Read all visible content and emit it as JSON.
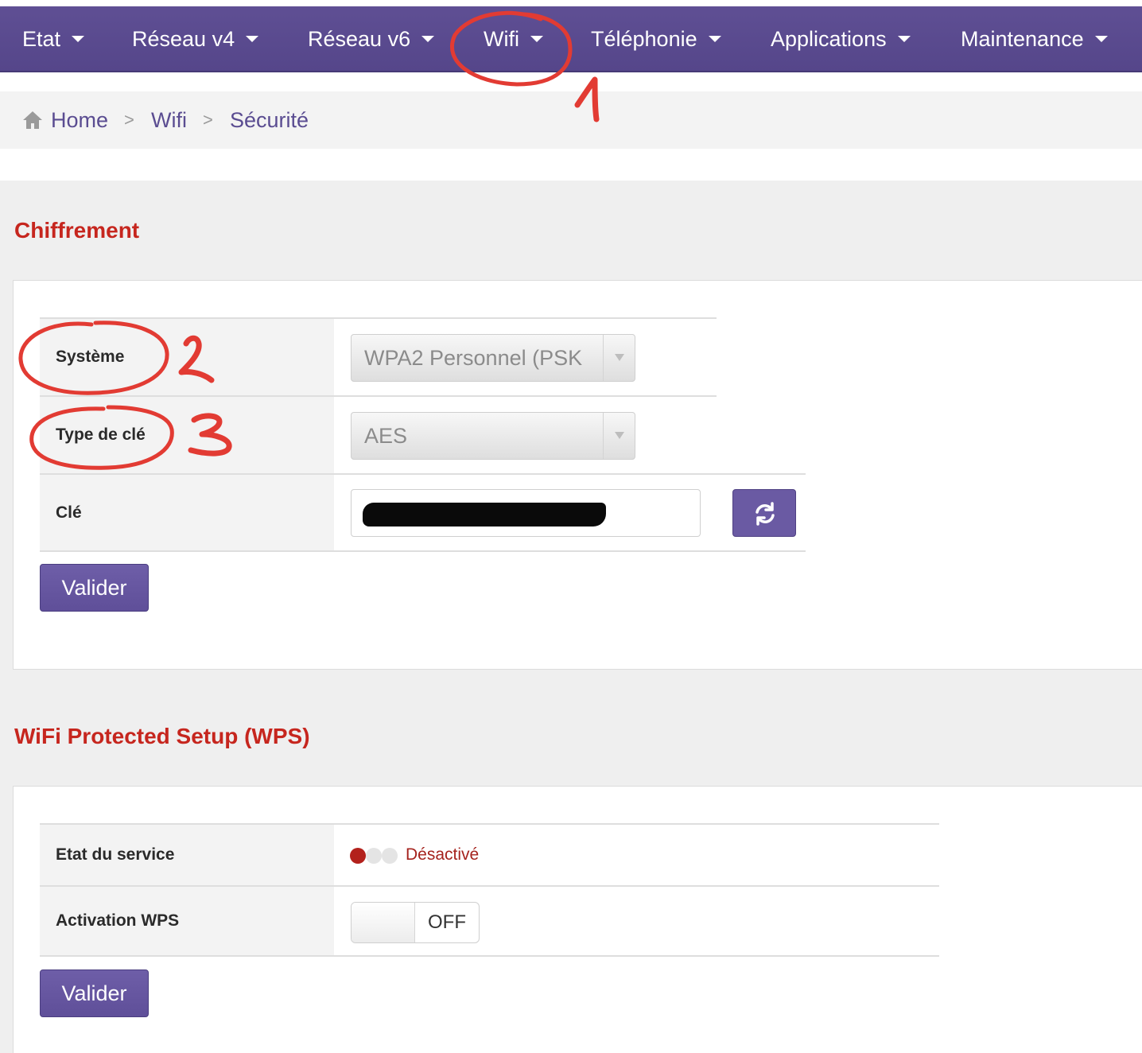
{
  "nav": {
    "items": [
      {
        "label": "Etat"
      },
      {
        "label": "Réseau v4"
      },
      {
        "label": "Réseau v6"
      },
      {
        "label": "Wifi"
      },
      {
        "label": "Téléphonie"
      },
      {
        "label": "Applications"
      },
      {
        "label": "Maintenance"
      }
    ]
  },
  "breadcrumb": {
    "items": [
      "Home",
      "Wifi",
      "Sécurité"
    ],
    "separator": ">"
  },
  "chiffrement": {
    "title": "Chiffrement",
    "systeme_label": "Système",
    "systeme_value": "WPA2 Personnel (PSK",
    "type_label": "Type de clé",
    "type_value": "AES",
    "cle_label": "Clé",
    "valider": "Valider"
  },
  "wps": {
    "title": "WiFi Protected Setup (WPS)",
    "etat_label": "Etat du service",
    "etat_value": "Désactivé",
    "activation_label": "Activation WPS",
    "toggle_value": "OFF",
    "valider": "Valider"
  },
  "annotations": [
    "1",
    "2",
    "3"
  ],
  "colors": {
    "nav": "#5a4b8f",
    "accent": "#6a5aa3",
    "section_title": "#c6261e",
    "status_off": "#a5231e",
    "annotation": "#e23b33"
  },
  "icons": {
    "home": "home-icon",
    "refresh": "refresh-icon",
    "caret": "chevron-down-icon"
  }
}
